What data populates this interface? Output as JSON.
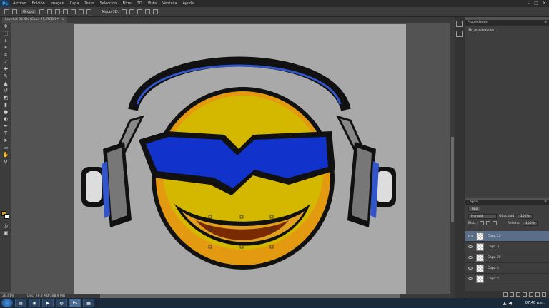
{
  "menubar": {
    "logo": "Ps",
    "items": [
      "Archivo",
      "Edición",
      "Imagen",
      "Capa",
      "Texto",
      "Selección",
      "Filtro",
      "3D",
      "Vista",
      "Ventana",
      "Ayuda"
    ],
    "window_controls": [
      "–",
      "□",
      "✕"
    ]
  },
  "options": {
    "group_select": "Grupo",
    "mode_3d": "Modo 3D:"
  },
  "document": {
    "tab_title": "Level at 36.4% (Capa 25, RGB/8*)",
    "tab_close": "×"
  },
  "status": {
    "zoom": "36.41%",
    "doc_size": "Doc: 26.2 MB/308.9 MB"
  },
  "properties": {
    "title": "Propiedades",
    "body": "Sin propiedades"
  },
  "layers": {
    "title": "Capas",
    "filter": "Tipo",
    "blend_mode": "Normal",
    "opacity_label": "Opacidad:",
    "opacity_value": "100%",
    "lock_label": "Bloq.:",
    "fill_label": "Relleno:",
    "fill_value": "100%",
    "rows": [
      {
        "name": "Capa 25",
        "selected": true
      },
      {
        "name": "Capa 3",
        "selected": false
      },
      {
        "name": "Capa 29",
        "selected": false
      },
      {
        "name": "Capa 4",
        "selected": false
      },
      {
        "name": "Capa 5",
        "selected": false
      }
    ]
  },
  "taskbar": {
    "time": "07:40 p.m."
  },
  "colors": {
    "foreground": "#d4a020",
    "background": "#ffffff",
    "selected_layer": "#5a6e8a"
  }
}
